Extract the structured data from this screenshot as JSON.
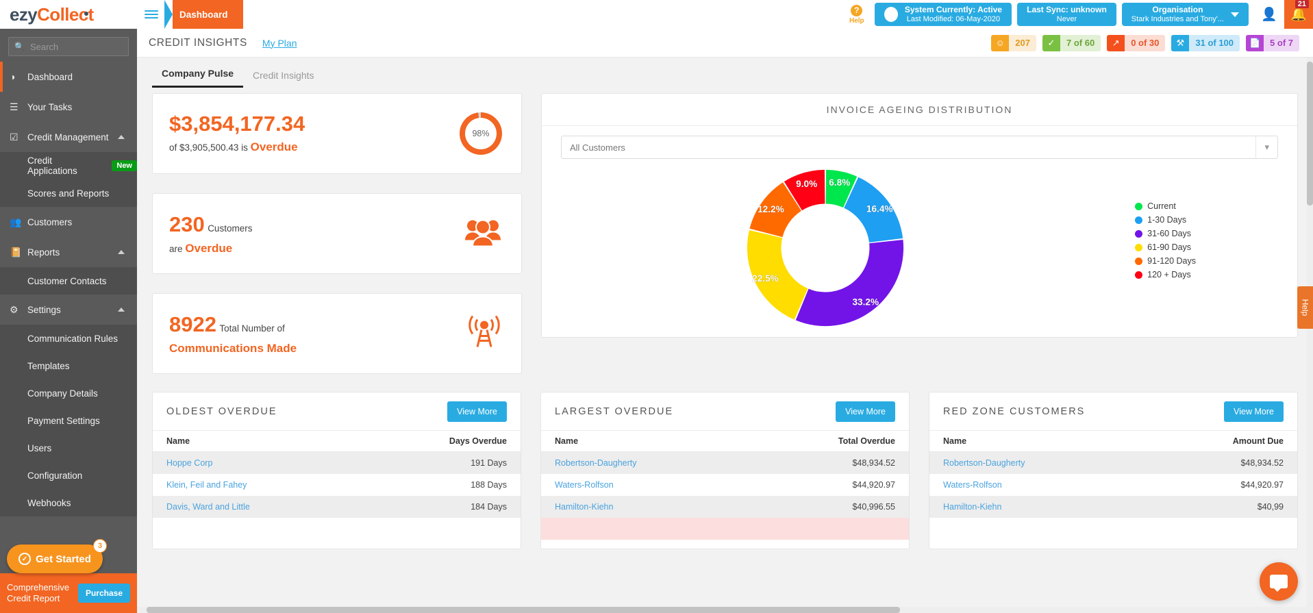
{
  "brand": {
    "name_part1": "ezy",
    "name_part2": "Collect",
    "accent": "#f26522",
    "dark": "#3f5060"
  },
  "topbar": {
    "breadcrumb": "Dashboard",
    "help_label": "Help",
    "help_icon": "question-mark-icon",
    "status_pill": {
      "title": "System Currently: Active",
      "subtitle": "Last Modified: 06-May-2020"
    },
    "sync_pill": {
      "title": "Last Sync: unknown",
      "subtitle": "Never"
    },
    "org_pill": {
      "title": "Organisation",
      "subtitle": "Stark Industries and Tony'..."
    },
    "user_icon": "user-avatar-icon",
    "bell_icon": "bell-icon",
    "notification_count": "21"
  },
  "sidebar": {
    "search_placeholder": "Search",
    "search_value": "",
    "items": [
      {
        "label": "Dashboard",
        "icon": "gauge-icon",
        "active": true
      },
      {
        "label": "Your Tasks",
        "icon": "list-icon",
        "active": false
      },
      {
        "label": "Credit Management",
        "icon": "checkbox-icon",
        "expanded": true
      },
      {
        "label": "Customers",
        "icon": "people-icon",
        "active": false
      },
      {
        "label": "Reports",
        "icon": "book-icon",
        "expanded": true
      },
      {
        "label": "Settings",
        "icon": "gears-icon",
        "expanded": true
      }
    ],
    "credit_management_children": [
      {
        "label": "Credit Applications",
        "badge": "New"
      },
      {
        "label": "Scores and Reports",
        "badge": ""
      }
    ],
    "reports_children": [
      {
        "label": "Customer Contacts"
      }
    ],
    "settings_children": [
      {
        "label": "Communication Rules"
      },
      {
        "label": "Templates"
      },
      {
        "label": "Company Details"
      },
      {
        "label": "Payment Settings"
      },
      {
        "label": "Users"
      },
      {
        "label": "Configuration"
      },
      {
        "label": "Webhooks"
      }
    ],
    "get_started": {
      "label": "Get Started",
      "count": "3",
      "icon": "check-circle-icon"
    },
    "promo": {
      "line1": "Comprehensive",
      "line2": "Credit Report",
      "button": "Purchase"
    }
  },
  "page": {
    "title": "CREDIT INSIGHTS",
    "my_plan": "My Plan",
    "kpis": [
      {
        "value": "207",
        "icon": "ribbon-icon",
        "icon_bg": "#f5a623",
        "chip_bg": "#fbecd5",
        "text": "#e09a1f"
      },
      {
        "value": "7 of 60",
        "icon": "check-circle-icon",
        "icon_bg": "#7ac143",
        "chip_bg": "#e2f0d5",
        "text": "#6ca63a"
      },
      {
        "value": "0 of 30",
        "icon": "trend-up-icon",
        "icon_bg": "#f4501e",
        "chip_bg": "#fbddd3",
        "text": "#e7552c"
      },
      {
        "value": "31 of 100",
        "icon": "pulse-icon",
        "icon_bg": "#29abe2",
        "chip_bg": "#cfeaf9",
        "text": "#2b9ed4"
      },
      {
        "value": "5 of 7",
        "icon": "document-icon",
        "icon_bg": "#b645d4",
        "chip_bg": "#eed7f5",
        "text": "#a83fc4"
      }
    ]
  },
  "tabs": [
    {
      "label": "Company Pulse",
      "active": true
    },
    {
      "label": "Credit Insights",
      "active": false
    }
  ],
  "stats": {
    "overdue_amount": {
      "value": "$3,854,177.34",
      "prefix": "of",
      "total": "$3,905,500.43",
      "mid": "is",
      "suffix": "Overdue",
      "gauge_percent": "98%",
      "gauge_value": 98
    },
    "overdue_customers": {
      "number": "230",
      "label": "Customers",
      "line2_prefix": "are",
      "line2_strong": "Overdue",
      "icon": "people-group-icon"
    },
    "communications": {
      "number": "8922",
      "label": "Total Number of",
      "line2": "Communications Made",
      "icon": "broadcast-tower-icon"
    }
  },
  "chart_panel": {
    "title": "INVOICE AGEING DISTRIBUTION",
    "customer_filter_value": "All Customers",
    "dropdown_icon": "chevron-down-icon"
  },
  "chart_data": {
    "type": "pie",
    "title": "INVOICE AGEING DISTRIBUTION",
    "subtitle": "All Customers",
    "donut": true,
    "legend_position": "right",
    "categories": [
      "Current",
      "1-30 Days",
      "31-60 Days",
      "61-90 Days",
      "91-120 Days",
      "120 + Days"
    ],
    "values": [
      6.8,
      16.4,
      33.2,
      22.5,
      12.2,
      9.0
    ],
    "labels": [
      "6.8%",
      "16.4%",
      "33.2%",
      "22.5%",
      "12.2%",
      "9.0%"
    ],
    "colors": [
      "#00e64d",
      "#1e9ff2",
      "#7214e8",
      "#ffdd00",
      "#ff6a00",
      "#ff0015"
    ],
    "unit": "percent"
  },
  "tables": [
    {
      "title": "OLDEST OVERDUE",
      "button": "View  More",
      "columns": [
        "Name",
        "Days Overdue"
      ],
      "rows": [
        {
          "name": "Hoppe Corp",
          "value": "191 Days",
          "style": "alt"
        },
        {
          "name": "Klein, Feil and Fahey",
          "value": "188 Days",
          "style": ""
        },
        {
          "name": "Davis, Ward and Little",
          "value": "184 Days",
          "style": "alt"
        }
      ]
    },
    {
      "title": "LARGEST OVERDUE",
      "button": "View  More",
      "columns": [
        "Name",
        "Total Overdue"
      ],
      "rows": [
        {
          "name": "Robertson-Daugherty",
          "value": "$48,934.52",
          "style": "alt"
        },
        {
          "name": "Waters-Rolfson",
          "value": "$44,920.97",
          "style": ""
        },
        {
          "name": "Hamilton-Kiehn",
          "value": "$40,996.55",
          "style": "alt"
        }
      ]
    },
    {
      "title": "RED ZONE CUSTOMERS",
      "button": "View  More",
      "columns": [
        "Name",
        "Amount Due"
      ],
      "rows": [
        {
          "name": "Robertson-Daugherty",
          "value": "$48,934.52",
          "style": "alt"
        },
        {
          "name": "Waters-Rolfson",
          "value": "$44,920.97",
          "style": ""
        },
        {
          "name": "Hamilton-Kiehn",
          "value": "$40,99",
          "style": "alt"
        }
      ]
    }
  ],
  "side_help_tab": {
    "label": "Help"
  },
  "chat_widget": {
    "icon": "chat-bubble-icon"
  }
}
